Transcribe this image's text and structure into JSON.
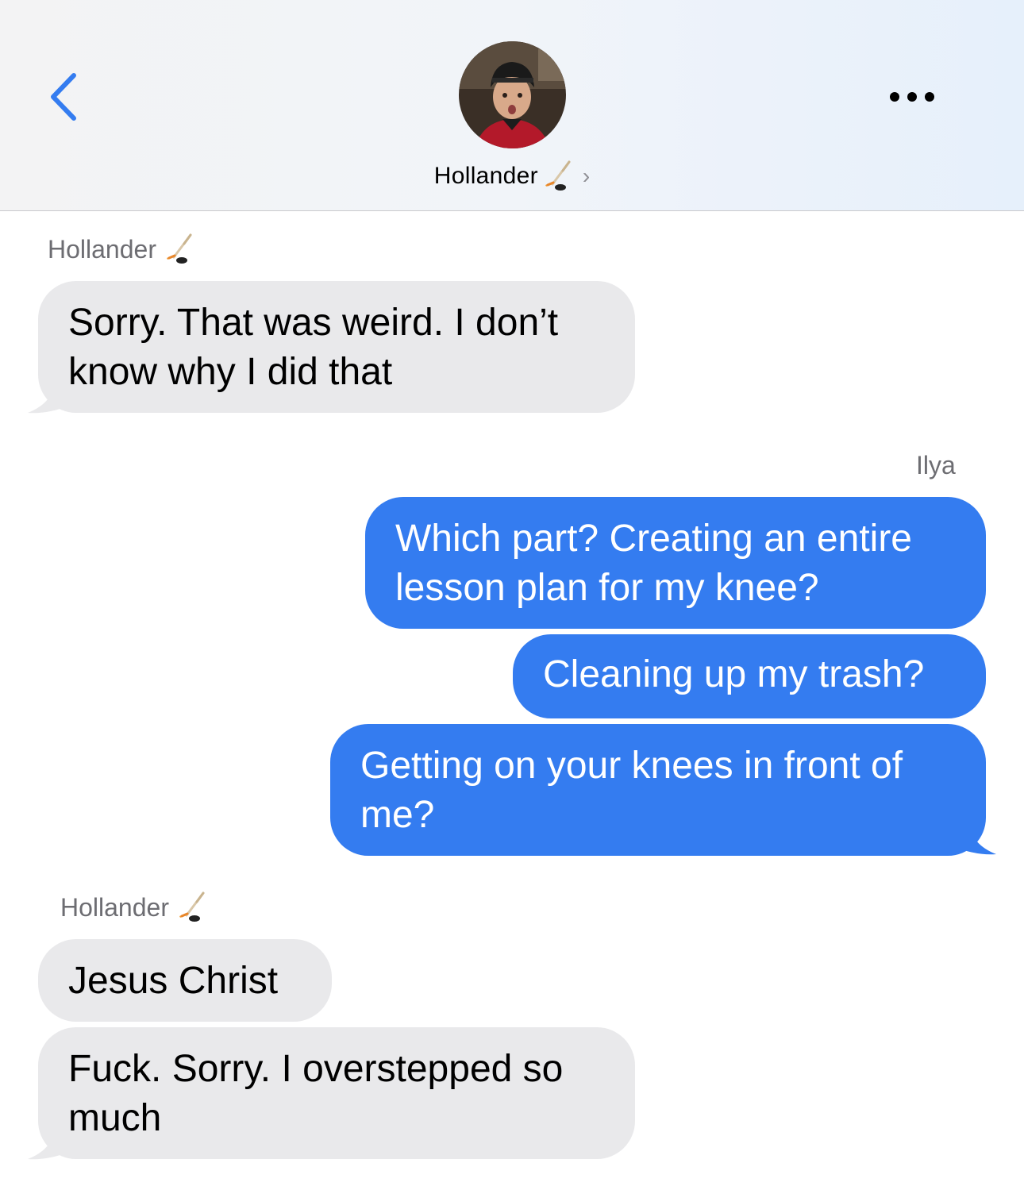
{
  "header": {
    "contact_name": "Hollander",
    "contact_emoji": "ice-hockey-icon",
    "back_icon": "chevron-left-icon",
    "more_icon": "more-dots-icon",
    "accent_color": "#347cf0"
  },
  "messages": [
    {
      "sender": "Hollander",
      "direction": "incoming",
      "text_lines": [
        "Sorry. That was weird. I don’t",
        "know why I did that"
      ]
    },
    {
      "sender": "Ilya",
      "direction": "outgoing",
      "text_lines": [
        "Which part? Creating an entire",
        "lesson plan for my knee?"
      ]
    },
    {
      "sender": "Ilya",
      "direction": "outgoing",
      "text_lines": [
        "Cleaning up my trash?"
      ]
    },
    {
      "sender": "Ilya",
      "direction": "outgoing",
      "text_lines": [
        "Getting on your knees in front of",
        "me?"
      ]
    },
    {
      "sender": "Hollander",
      "direction": "incoming",
      "text_lines": [
        "Jesus Christ"
      ]
    },
    {
      "sender": "Hollander",
      "direction": "incoming",
      "text_lines": [
        "Fuck. Sorry. I overstepped so",
        "much"
      ]
    }
  ],
  "colors": {
    "incoming_bubble": "#e9e9eb",
    "outgoing_bubble": "#347cf0"
  }
}
